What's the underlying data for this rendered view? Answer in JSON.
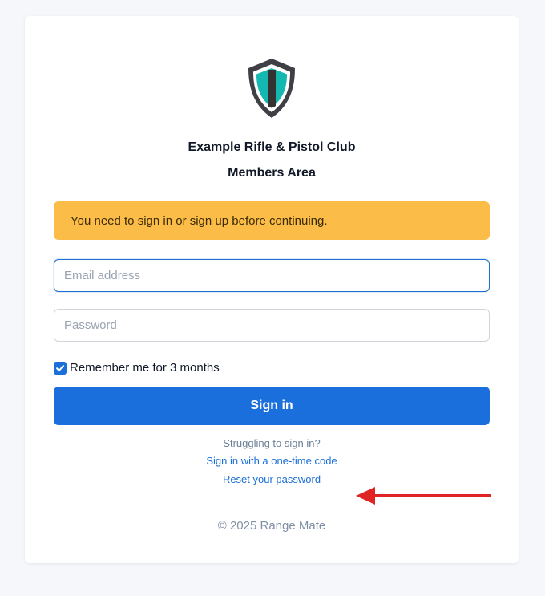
{
  "brand": {
    "club_name": "Example Rifle & Pistol Club",
    "area_name": "Members Area",
    "logo_icon": "shield-icon",
    "logo_colors": {
      "outline": "#3f3f46",
      "accent": "#14b8b0",
      "core": "#333333"
    }
  },
  "alert": {
    "message": "You need to sign in or sign up before continuing.",
    "color": "#fbbd47"
  },
  "form": {
    "email_placeholder": "Email address",
    "password_placeholder": "Password",
    "remember_label": "Remember me for 3 months",
    "remember_checked": true,
    "submit_label": "Sign in",
    "submit_color": "#1a6fdc"
  },
  "help": {
    "struggling_text": "Struggling to sign in?",
    "otc_link": "Sign in with a one-time code",
    "reset_link": "Reset your password"
  },
  "annotation": {
    "icon": "arrow-left-icon",
    "color": "#e02424"
  },
  "footer": {
    "copyright": "© 2025 Range Mate"
  }
}
